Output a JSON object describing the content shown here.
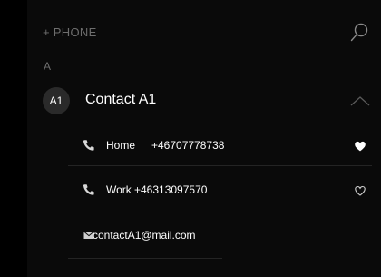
{
  "topbar": {
    "add_phone_label": "+ PHONE",
    "search_icon": "search-icon"
  },
  "section": {
    "letter": "A"
  },
  "contact": {
    "initials": "A1",
    "name": "Contact A1",
    "expanded": true,
    "entries": [
      {
        "type": "phone",
        "label": "Home",
        "value": "+46707778738",
        "favorite": true,
        "icon": "phone-icon"
      },
      {
        "type": "phone",
        "label": "Work",
        "value": "+46313097570",
        "favorite": false,
        "icon": "phone-icon"
      },
      {
        "type": "email",
        "label": "",
        "value": "contactA1@mail.com",
        "icon": "mail-icon"
      }
    ]
  },
  "colors": {
    "background": "#000000",
    "panel": "#0a0a0a",
    "muted_text": "#6e6e6e",
    "avatar_bg": "#2a2a2a",
    "divider": "#242424"
  }
}
